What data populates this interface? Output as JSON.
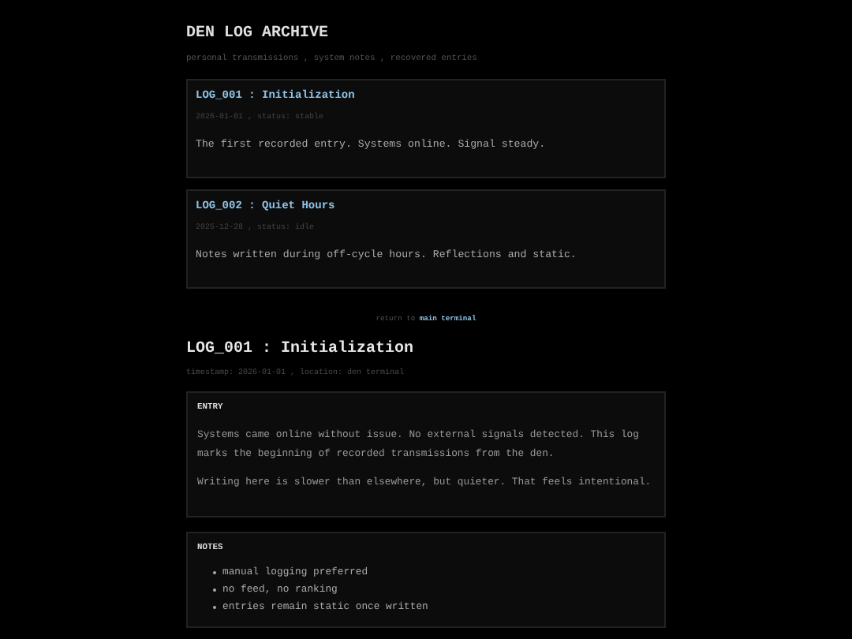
{
  "header": {
    "title": "DEN LOG ARCHIVE",
    "subtitle": "personal transmissions , system notes , recovered entries"
  },
  "logs": [
    {
      "title": "LOG_001 : Initialization",
      "meta": "2026-01-01 , status: stable",
      "summary": "The first recorded entry. Systems online. Signal steady."
    },
    {
      "title": "LOG_002 : Quiet Hours",
      "meta": "2025-12-28 , status: idle",
      "summary": "Notes written during off-cycle hours. Reflections and static."
    }
  ],
  "footer": {
    "prefix": "return to",
    "link": "main terminal"
  },
  "entry": {
    "title": "LOG_001 : Initialization",
    "meta": "timestamp: 2026-01-01 , location: den terminal",
    "sections": [
      {
        "kind": "text",
        "heading": "ENTRY",
        "paragraphs": [
          "Systems came online without issue. No external signals detected. This log marks the beginning of recorded transmissions from the den.",
          "Writing here is slower than elsewhere, but quieter. That feels intentional."
        ]
      },
      {
        "kind": "list",
        "heading": "NOTES",
        "items": [
          "manual logging preferred",
          "no feed, no ranking",
          "entries remain static once written"
        ]
      }
    ]
  }
}
